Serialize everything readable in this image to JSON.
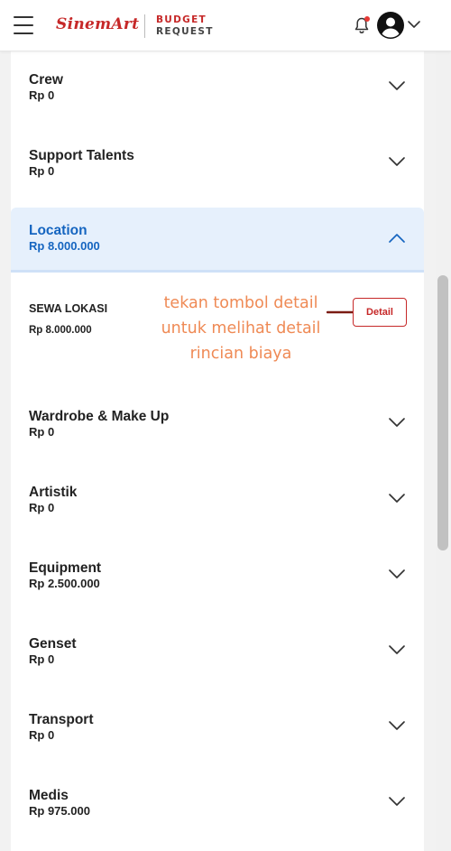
{
  "header": {
    "logo_text": "SinemArt",
    "title_line1": "BUDGET",
    "title_line2": "REQUEST"
  },
  "categories": [
    {
      "title": "Crew",
      "amount": "Rp 0"
    },
    {
      "title": "Support Talents",
      "amount": "Rp 0"
    },
    {
      "title": "Location",
      "amount": "Rp 8.000.000",
      "expanded": true
    },
    {
      "title": "Wardrobe & Make Up",
      "amount": "Rp 0"
    },
    {
      "title": "Artistik",
      "amount": "Rp 0"
    },
    {
      "title": "Equipment",
      "amount": "Rp 2.500.000"
    },
    {
      "title": "Genset",
      "amount": "Rp 0"
    },
    {
      "title": "Transport",
      "amount": "Rp 0"
    },
    {
      "title": "Medis",
      "amount": "Rp 975.000"
    }
  ],
  "location_item": {
    "title": "SEWA LOKASI",
    "amount": "Rp 8.000.000",
    "detail_label": "Detail"
  },
  "hint": {
    "line1": "tekan tombol detail",
    "line2": "untuk melihat detail",
    "line3": "rincian biaya"
  },
  "colors": {
    "brand": "#c62828",
    "active_text": "#1565c0",
    "active_bg": "#e6f0fc",
    "hint": "#ef8a55",
    "arrow": "#7b1c13"
  },
  "icons": [
    "menu-icon",
    "bell-icon",
    "user-avatar-icon",
    "chevron-down-icon",
    "chevron-up-icon",
    "arrow-right-icon"
  ]
}
